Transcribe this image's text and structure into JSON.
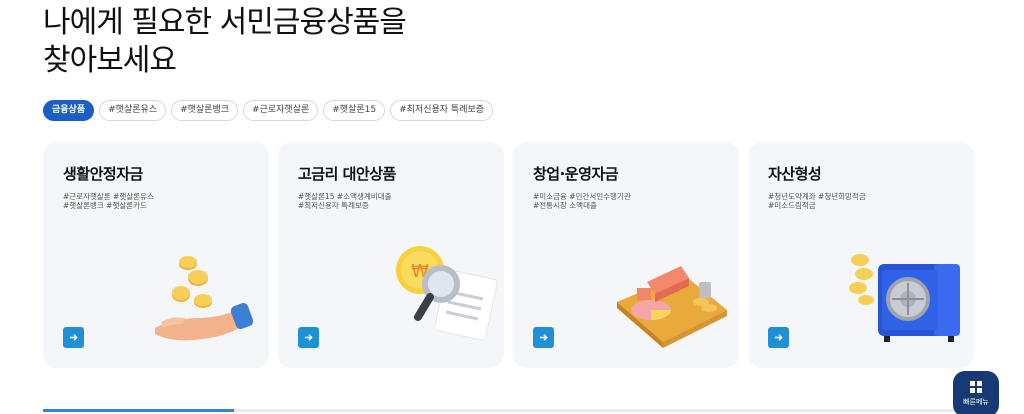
{
  "headline": {
    "line1": "나에게 필요한 서민금융상품을",
    "line2": "찾아보세요"
  },
  "tags": [
    "금융상품",
    "#햇살론유스",
    "#햇살론뱅크",
    "#근로자햇살론",
    "#햇살론15",
    "#최저신용자 특례보증"
  ],
  "cards": [
    {
      "title": "생활안정자금",
      "tags": [
        "#근로자햇살론 #햇살론유스",
        "#햇살론뱅크 #햇살론카드"
      ],
      "icon": "coins-hand-icon"
    },
    {
      "title": "고금리 대안상품",
      "tags": [
        "#햇살론15 #소액생계비대출",
        "#최저신용자 특례보증"
      ],
      "icon": "magnifier-document-icon"
    },
    {
      "title": "창업·운영자금",
      "tags": [
        "#미소금융 #민간서민수행기관",
        "#전통시장 소액대출"
      ],
      "icon": "chart-board-icon"
    },
    {
      "title": "자산형성",
      "tags": [
        "#청년도약계좌 #청년희망적금",
        "#미소드림적금"
      ],
      "icon": "safe-coins-icon"
    }
  ],
  "quick_menu": {
    "label": "빠른메뉴",
    "icon": "grid-icon"
  },
  "carousel_progress": 0.205,
  "colors": {
    "accent": "#1b5fc4",
    "go_button": "#1f8fd6",
    "card_bg": "#f4f6fa",
    "fab": "#173a74"
  }
}
